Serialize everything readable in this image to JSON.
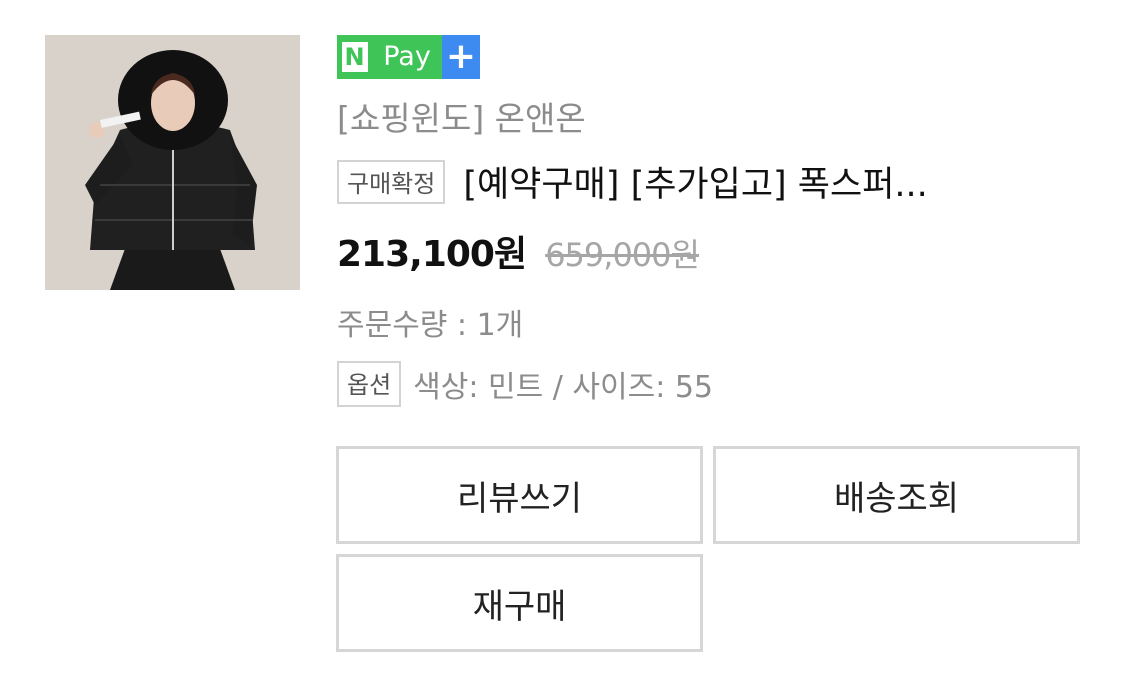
{
  "order": {
    "npay": {
      "n": "N",
      "pay": "Pay",
      "plus": "+"
    },
    "store_name": "[쇼핑윈도] 온앤온",
    "status_tag": "구매확정",
    "product_name": "[예약구매] [추가입고] 폭스퍼...",
    "price": "213,100원",
    "original_price": "659,000원",
    "quantity_text": "주문수량 : 1개",
    "option_tag": "옵션",
    "option_text": "색상: 민트 / 사이즈: 55",
    "image": {
      "description_icon": "product-photo-icon"
    }
  },
  "actions": {
    "review_label": "리뷰쓰기",
    "tracking_label": "배송조회",
    "rebuy_label": "재구매"
  },
  "colors": {
    "npay_green": "#3ec457",
    "npay_blue": "#3d8af0",
    "muted_text": "#8c8c8c",
    "border": "#d6d6d6"
  }
}
